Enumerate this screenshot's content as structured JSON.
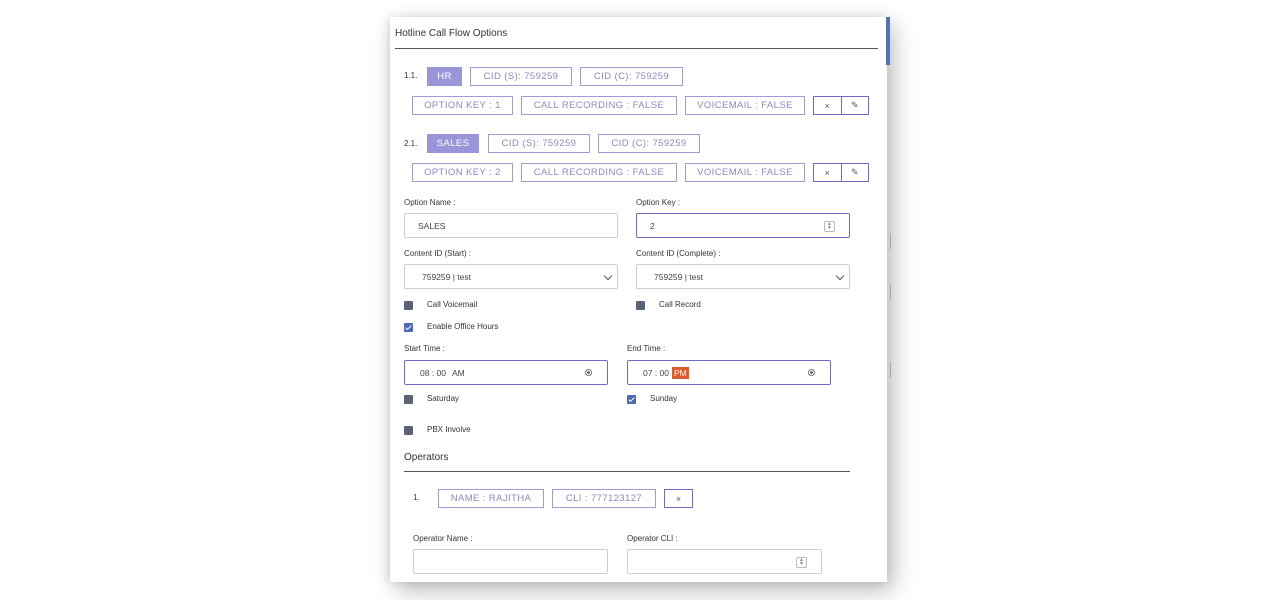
{
  "panel": {
    "title": "Hotline Call Flow Options"
  },
  "options": [
    {
      "number": "1.1.",
      "name": "HR",
      "cid_start": "CID (S): 759259",
      "cid_complete": "CID (C): 759259",
      "option_key": "OPTION KEY : 1",
      "call_recording": "CALL RECORDING : FALSE",
      "voicemail": "VOICEMAIL : FALSE"
    },
    {
      "number": "2.1.",
      "name": "SALES",
      "cid_start": "CID (S): 759259",
      "cid_complete": "CID (C): 759259",
      "option_key": "OPTION KEY : 2",
      "call_recording": "CALL RECORDING : FALSE",
      "voicemail": "VOICEMAIL : FALSE"
    }
  ],
  "icons": {
    "delete": "×",
    "edit": "✎"
  },
  "form": {
    "option_name_label": "Option Name :",
    "option_name_value": "SALES",
    "option_key_label": "Option Key :",
    "option_key_value": "2",
    "content_start_label": "Content ID (Start) :",
    "content_start_value": "759259 | test",
    "content_complete_label": "Content ID (Complete) :",
    "content_complete_value": "759259 | test",
    "call_voicemail_label": "Call Voicemail",
    "call_record_label": "Call Record",
    "enable_office_hours_label": "Enable Office Hours",
    "start_time_label": "Start Time :",
    "start_time_value": "08 : 00",
    "start_time_ampm": "AM",
    "end_time_label": "End Time :",
    "end_time_value": "07 : 00",
    "end_time_ampm": "PM",
    "saturday_label": "Saturday",
    "sunday_label": "Sunday",
    "pbx_involve_label": "PBX Involve"
  },
  "operators": {
    "title": "Operators",
    "items": [
      {
        "number": "1.",
        "name": "NAME : RAJITHA",
        "cli": "CLI : 777123127"
      }
    ],
    "operator_name_label": "Operator Name :",
    "operator_cli_label": "Operator CLI :"
  }
}
